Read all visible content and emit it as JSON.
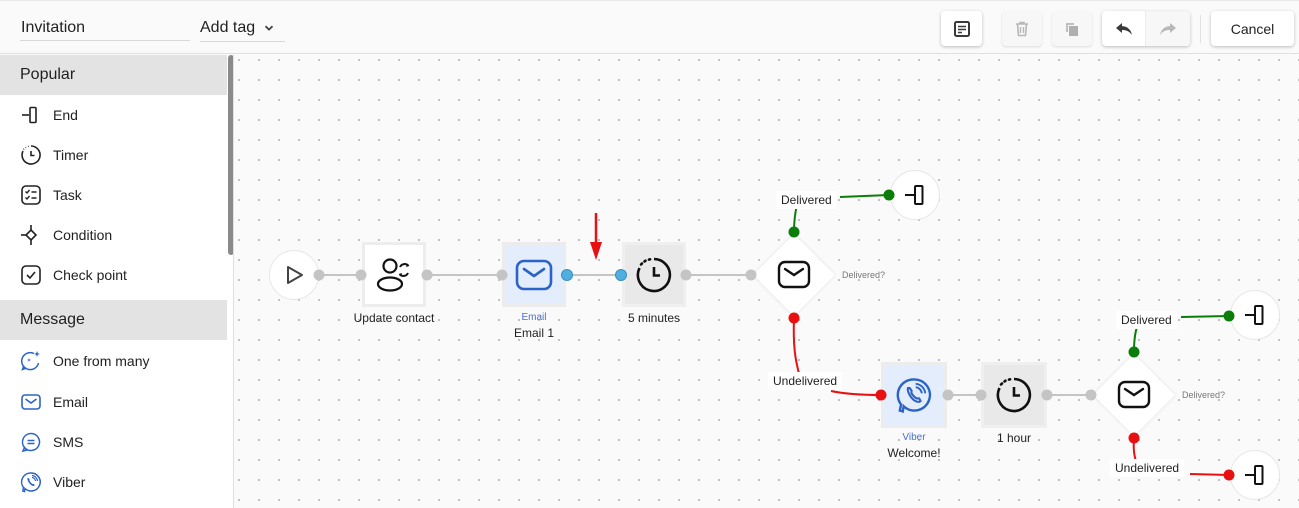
{
  "header": {
    "title_value": "Invitation",
    "tag_select_label": "Add tag",
    "toolbar": {
      "note_icon": "note-icon",
      "delete_icon": "trash-icon",
      "copy_icon": "copy-icon",
      "undo_icon": "undo-icon",
      "redo_icon": "redo-icon",
      "cancel_label": "Cancel"
    }
  },
  "sidebar": {
    "sections": [
      {
        "title": "Popular",
        "items": [
          {
            "label": "End",
            "icon": "end-icon"
          },
          {
            "label": "Timer",
            "icon": "timer-icon"
          },
          {
            "label": "Task",
            "icon": "task-icon"
          },
          {
            "label": "Condition",
            "icon": "condition-icon"
          },
          {
            "label": "Check point",
            "icon": "checkpoint-icon"
          }
        ]
      },
      {
        "title": "Message",
        "items": [
          {
            "label": "One from many",
            "icon": "sparkle-chat-icon"
          },
          {
            "label": "Email",
            "icon": "email-icon"
          },
          {
            "label": "SMS",
            "icon": "sms-icon"
          },
          {
            "label": "Viber",
            "icon": "viber-icon"
          }
        ]
      }
    ]
  },
  "flow": {
    "nodes": {
      "start": {
        "icon": "play-icon"
      },
      "update_contact": {
        "label": "Update contact",
        "icon": "user-sync-icon"
      },
      "email1": {
        "type": "Email",
        "label": "Email 1",
        "icon": "email-icon"
      },
      "timer1": {
        "label": "5 minutes",
        "icon": "timer-icon"
      },
      "cond1": {
        "label": "Delivered?",
        "icon": "email-icon"
      },
      "end1": {
        "icon": "end-icon"
      },
      "viber1": {
        "type": "Viber",
        "label": "Welcome!",
        "icon": "viber-icon"
      },
      "timer2": {
        "label": "1 hour",
        "icon": "timer-icon"
      },
      "cond2": {
        "label": "Delivered?",
        "icon": "email-icon"
      },
      "end2": {
        "icon": "end-icon"
      },
      "end3": {
        "icon": "end-icon"
      }
    },
    "edge_labels": {
      "delivered": "Delivered",
      "undelivered": "Undelivered"
    },
    "colors": {
      "delivered": "#0a7d0a",
      "undelivered": "#e81010",
      "selected_port": "#4fb0e0",
      "port": "#c4c4c4",
      "message_node_bg": "#e3edfb",
      "message_icon": "#2b63c8",
      "timer_node_bg": "#e9e9e9",
      "indicator_arrow": "#e81010"
    }
  }
}
